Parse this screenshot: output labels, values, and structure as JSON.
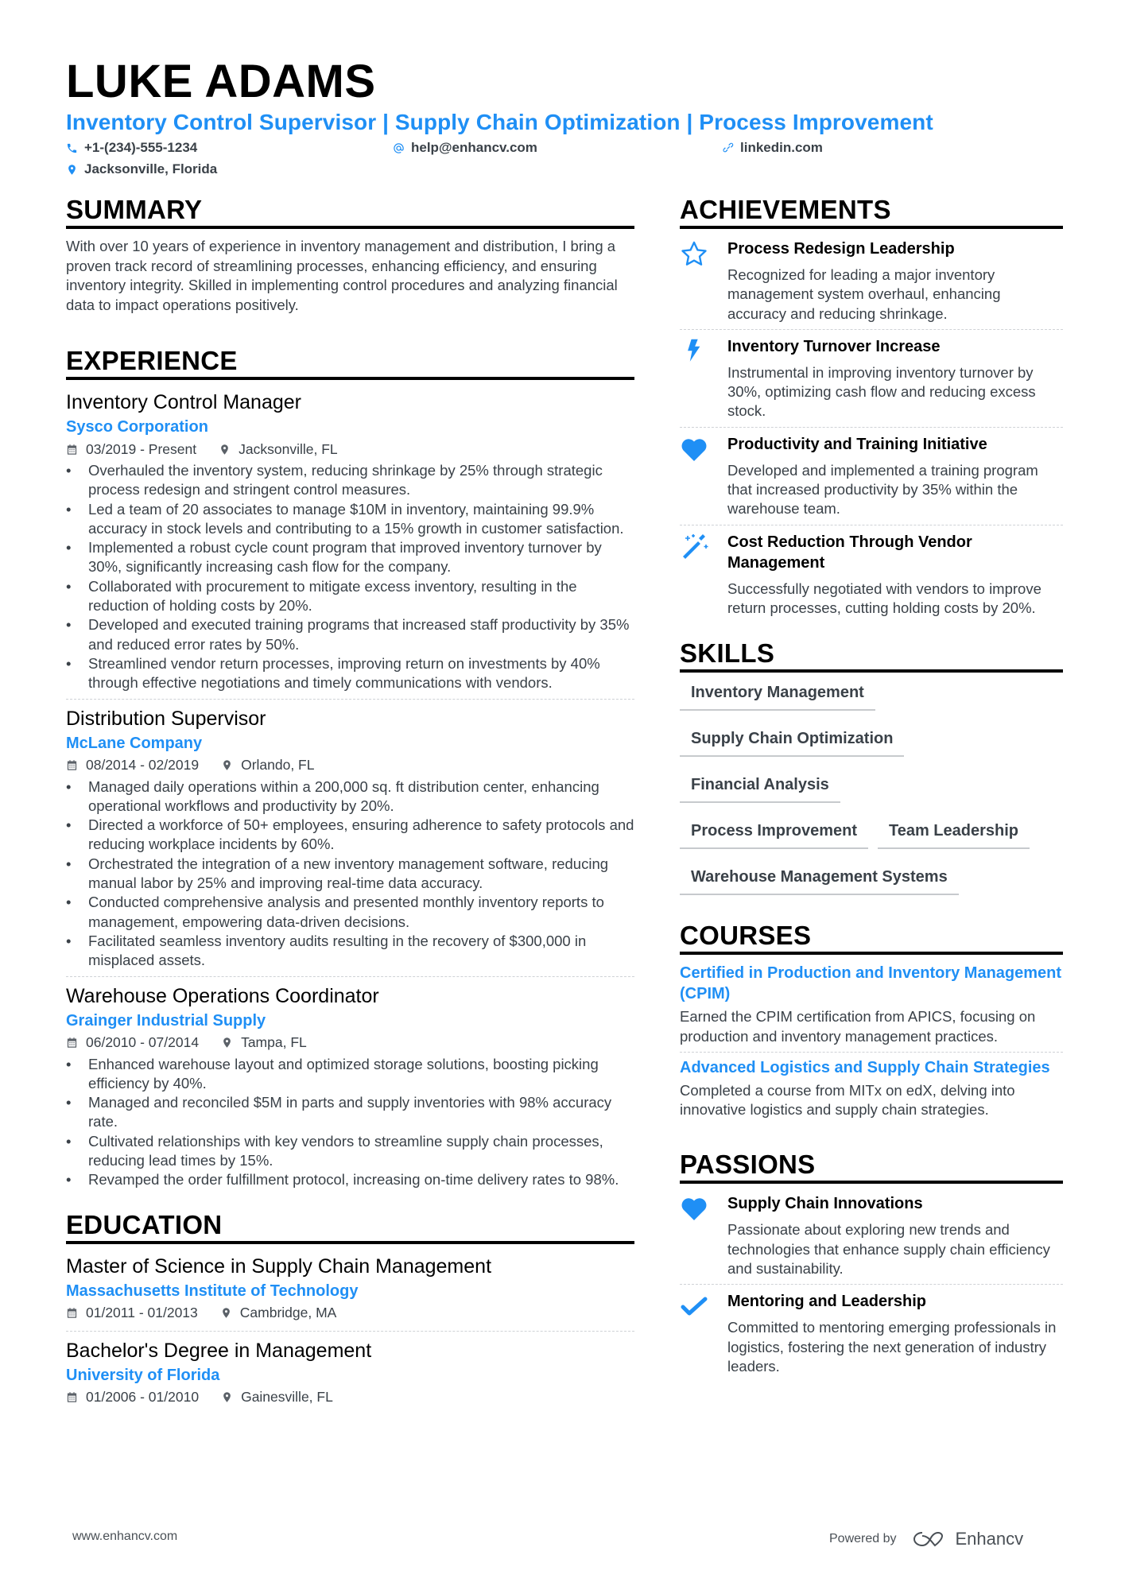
{
  "header": {
    "name": "LUKE ADAMS",
    "headline": "Inventory Control Supervisor | Supply Chain Optimization | Process Improvement",
    "phone": "+1-(234)-555-1234",
    "email": "help@enhancv.com",
    "link": "linkedin.com",
    "location": "Jacksonville, Florida"
  },
  "summary": {
    "title": "SUMMARY",
    "text": "With over 10 years of experience in inventory management and distribution, I bring a proven track record of streamlining processes, enhancing efficiency, and ensuring inventory integrity. Skilled in implementing control procedures and analyzing financial data to impact operations positively."
  },
  "experience": {
    "title": "EXPERIENCE",
    "jobs": [
      {
        "role": "Inventory Control Manager",
        "company": "Sysco Corporation",
        "dates": "03/2019 - Present",
        "location": "Jacksonville, FL",
        "bullets": [
          "Overhauled the inventory system, reducing shrinkage by 25% through strategic process redesign and stringent control measures.",
          "Led a team of 20 associates to manage $10M in inventory, maintaining 99.9% accuracy in stock levels and contributing to a 15% growth in customer satisfaction.",
          "Implemented a robust cycle count program that improved inventory turnover by 30%, significantly increasing cash flow for the company.",
          "Collaborated with procurement to mitigate excess inventory, resulting in the reduction of holding costs by 20%.",
          "Developed and executed training programs that increased staff productivity by 35% and reduced error rates by 50%.",
          "Streamlined vendor return processes, improving return on investments by 40% through effective negotiations and timely communications with vendors."
        ]
      },
      {
        "role": "Distribution Supervisor",
        "company": "McLane Company",
        "dates": "08/2014 - 02/2019",
        "location": "Orlando, FL",
        "bullets": [
          "Managed daily operations within a 200,000 sq. ft distribution center, enhancing operational workflows and productivity by 20%.",
          "Directed a workforce of 50+ employees, ensuring adherence to safety protocols and reducing workplace incidents by 60%.",
          "Orchestrated the integration of a new inventory management software, reducing manual labor by 25% and improving real-time data accuracy.",
          "Conducted comprehensive analysis and presented monthly inventory reports to management, empowering data-driven decisions.",
          "Facilitated seamless inventory audits resulting in the recovery of $300,000 in misplaced assets."
        ]
      },
      {
        "role": "Warehouse Operations Coordinator",
        "company": "Grainger Industrial Supply",
        "dates": "06/2010 - 07/2014",
        "location": "Tampa, FL",
        "bullets": [
          "Enhanced warehouse layout and optimized storage solutions, boosting picking efficiency by 40%.",
          "Managed and reconciled $5M in parts and supply inventories with 98% accuracy rate.",
          "Cultivated relationships with key vendors to streamline supply chain processes, reducing lead times by 15%.",
          "Revamped the order fulfillment protocol, increasing on-time delivery rates to 98%."
        ]
      }
    ]
  },
  "education": {
    "title": "EDUCATION",
    "items": [
      {
        "degree": "Master of Science in Supply Chain Management",
        "school": "Massachusetts Institute of Technology",
        "dates": "01/2011 - 01/2013",
        "location": "Cambridge, MA"
      },
      {
        "degree": "Bachelor's Degree in Management",
        "school": "University of Florida",
        "dates": "01/2006 - 01/2010",
        "location": "Gainesville, FL"
      }
    ]
  },
  "achievements": {
    "title": "ACHIEVEMENTS",
    "items": [
      {
        "icon": "star-icon",
        "title": "Process Redesign Leadership",
        "desc": "Recognized for leading a major inventory management system overhaul, enhancing accuracy and reducing shrinkage."
      },
      {
        "icon": "lightning-icon",
        "title": "Inventory Turnover Increase",
        "desc": "Instrumental in improving inventory turnover by 30%, optimizing cash flow and reducing excess stock."
      },
      {
        "icon": "heart-icon",
        "title": "Productivity and Training Initiative",
        "desc": "Developed and implemented a training program that increased productivity by 35% within the warehouse team."
      },
      {
        "icon": "magic-wand-icon",
        "title": "Cost Reduction Through Vendor Management",
        "desc": "Successfully negotiated with vendors to improve return processes, cutting holding costs by 20%."
      }
    ]
  },
  "skills": {
    "title": "SKILLS",
    "items": [
      "Inventory Management",
      "Supply Chain Optimization",
      "Financial Analysis",
      "Process Improvement",
      "Team Leadership",
      "Warehouse Management Systems"
    ]
  },
  "courses": {
    "title": "COURSES",
    "items": [
      {
        "title": "Certified in Production and Inventory Management (CPIM)",
        "desc": "Earned the CPIM certification from APICS, focusing on production and inventory management practices."
      },
      {
        "title": "Advanced Logistics and Supply Chain Strategies",
        "desc": "Completed a course from MITx on edX, delving into innovative logistics and supply chain strategies."
      }
    ]
  },
  "passions": {
    "title": "PASSIONS",
    "items": [
      {
        "icon": "heart-icon",
        "title": "Supply Chain Innovations",
        "desc": "Passionate about exploring new trends and technologies that enhance supply chain efficiency and sustainability."
      },
      {
        "icon": "checkmark-icon",
        "title": "Mentoring and Leadership",
        "desc": "Committed to mentoring emerging professionals in logistics, fostering the next generation of industry leaders."
      }
    ]
  },
  "footer": {
    "site": "www.enhancv.com",
    "powered_by": "Powered by",
    "brand": "Enhancv"
  },
  "colors": {
    "accent": "#1f8ff5",
    "text": "#3a4148",
    "heading": "#000000"
  }
}
